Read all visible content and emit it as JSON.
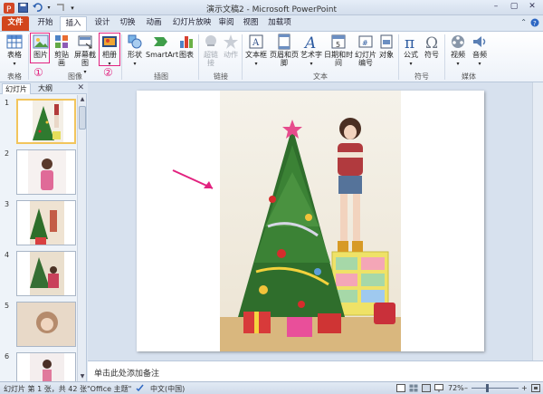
{
  "window": {
    "title": "演示文稿2 - Microsoft PowerPoint",
    "minimize": "–",
    "restore": "▢",
    "close": "✕"
  },
  "tabs": [
    {
      "id": "file",
      "label": "文件"
    },
    {
      "id": "home",
      "label": "开始"
    },
    {
      "id": "insert",
      "label": "插入"
    },
    {
      "id": "design",
      "label": "设计"
    },
    {
      "id": "transitions",
      "label": "切换"
    },
    {
      "id": "animations",
      "label": "动画"
    },
    {
      "id": "slideshow",
      "label": "幻灯片放映"
    },
    {
      "id": "review",
      "label": "审阅"
    },
    {
      "id": "view",
      "label": "视图"
    },
    {
      "id": "addins",
      "label": "加载项"
    }
  ],
  "active_tab": "插入",
  "ribbon": {
    "table": "表格",
    "picture": "图片",
    "clipart": "剪贴画",
    "screenshot": "屏幕截图",
    "album": "相册",
    "shapes": "形状",
    "smartart": "SmartArt",
    "chart": "图表",
    "hyperlink": "超链接",
    "action": "动作",
    "textbox": "文本框",
    "headerfooter": "页眉和页脚",
    "wordart": "艺术字",
    "datetime": "日期和时间",
    "slidenumber_1": "幻灯片",
    "slidenumber_2": "编号",
    "object": "对象",
    "equation": "公式",
    "symbol": "符号",
    "video": "视频",
    "audio": "音频",
    "groups": {
      "tables": "表格",
      "images": "图像",
      "illustrations": "插图",
      "links": "链接",
      "text": "文本",
      "symbols": "符号",
      "media": "媒体"
    },
    "annotations": {
      "one": "①",
      "two": "②"
    }
  },
  "left_pane": {
    "tab_slides": "幻灯片",
    "tab_outline": "大纲",
    "close": "✕",
    "slide_numbers": [
      "1",
      "2",
      "3",
      "4",
      "5",
      "6"
    ]
  },
  "notes_placeholder": "单击此处添加备注",
  "status": {
    "slide_info": "幻灯片 第 1 张，共 42 张",
    "theme": "\"Office 主题\"",
    "language": "中文(中国)",
    "zoom": "72%",
    "zoom_level": 0.72
  },
  "colors": {
    "file_tab": "#d2461c",
    "highlight": "#e2227f",
    "selected_thumb": "#f2c55c"
  }
}
